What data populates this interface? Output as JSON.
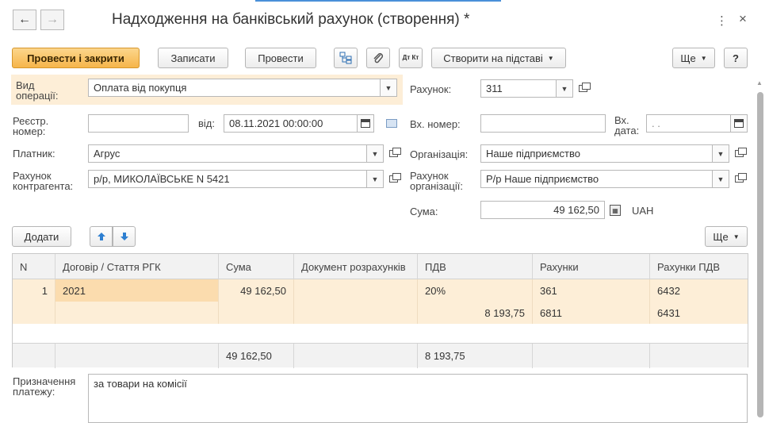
{
  "header": {
    "title": "Надходження на банківський рахунок (створення) *",
    "back": "←",
    "forward": "→",
    "more": "⋮",
    "close": "×"
  },
  "toolbar": {
    "post_close": "Провести і закрити",
    "save": "Записати",
    "post": "Провести",
    "create_based": "Створити на підставі",
    "more": "Ще",
    "help": "?",
    "dt_kt": "Дт Кт"
  },
  "form": {
    "op_type_label": "Вид операції:",
    "op_type_value": "Оплата від покупця",
    "reg_num_label": "Реєстр. номер:",
    "reg_num_value": "",
    "from_label": "від:",
    "date_value": "08.11.2021 00:00:00",
    "payer_label": "Платник:",
    "payer_value": "Агрус",
    "cp_account_label": "Рахунок контрагента:",
    "cp_account_value": "р/р, МИКОЛАЇВСЬКЕ N 5421",
    "account_label": "Рахунок:",
    "account_value": "311",
    "in_num_label": "Вх. номер:",
    "in_num_value": "",
    "in_date_label": "Вх. дата:",
    "in_date_value": " .  .",
    "org_label": "Організація:",
    "org_value": "Наше підприємство",
    "org_account_label": "Рахунок організації:",
    "org_account_value": "Р/р Наше підприємство",
    "sum_label": "Сума:",
    "sum_value": "49 162,50",
    "currency": "UAH"
  },
  "table_toolbar": {
    "add": "Додати",
    "more": "Ще"
  },
  "table": {
    "columns": [
      "N",
      "Договір / Стаття РГК",
      "Сума",
      "Документ розрахунків",
      "ПДВ",
      "Рахунки",
      "Рахунки ПДВ"
    ],
    "rows": [
      {
        "n": "1",
        "contract": "2021",
        "sum": "49 162,50",
        "doc": "",
        "vat": "20%",
        "accounts": "361",
        "vat_accounts": "6432"
      },
      {
        "n": "",
        "contract": "",
        "sum": "",
        "doc": "",
        "vat": "8 193,75",
        "accounts": "6811",
        "vat_accounts": "6431"
      }
    ],
    "totals": {
      "sum": "49 162,50",
      "vat": "8 193,75"
    }
  },
  "purpose": {
    "label": "Призначення платежу:",
    "value": "за товари на комісії"
  }
}
